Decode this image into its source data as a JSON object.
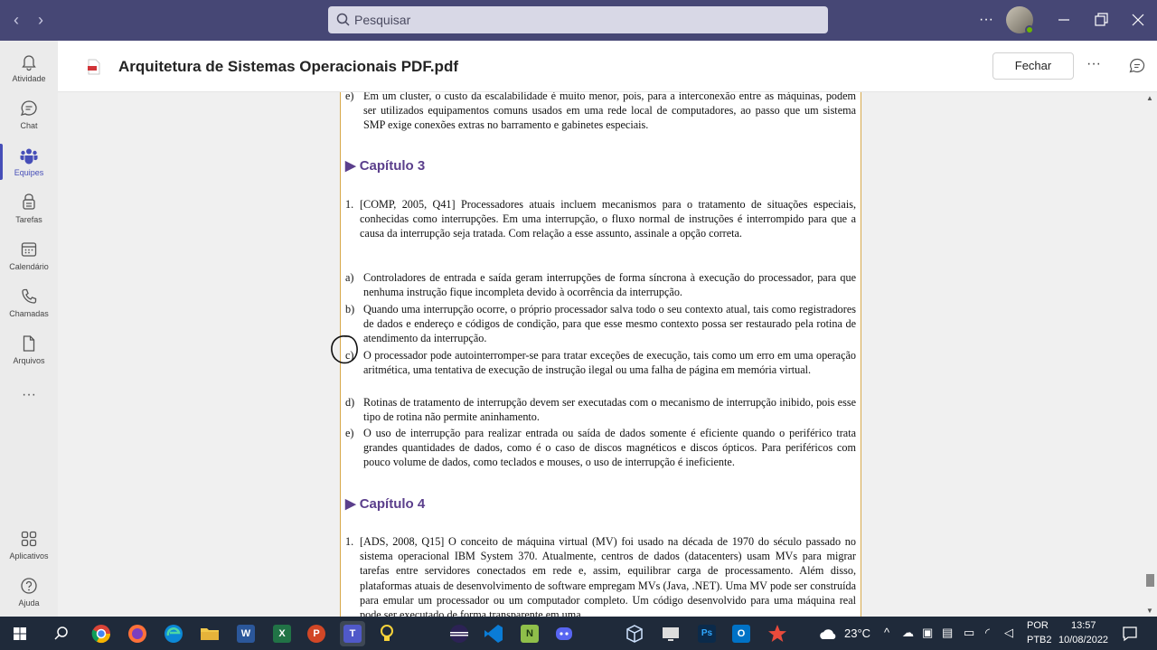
{
  "titlebar": {
    "search_placeholder": "Pesquisar",
    "back_icon": "arrow-left-icon",
    "forward_icon": "arrow-right-icon",
    "more_label": "···"
  },
  "rail": {
    "items": [
      {
        "label": "Atividade",
        "icon": "bell-icon"
      },
      {
        "label": "Chat",
        "icon": "chat-icon"
      },
      {
        "label": "Equipes",
        "icon": "teams-icon",
        "active": true
      },
      {
        "label": "Tarefas",
        "icon": "tasks-icon"
      },
      {
        "label": "Calendário",
        "icon": "calendar-icon"
      },
      {
        "label": "Chamadas",
        "icon": "phone-icon"
      },
      {
        "label": "Arquivos",
        "icon": "file-icon"
      }
    ],
    "more": "···",
    "apps_label": "Aplicativos",
    "help_label": "Ajuda"
  },
  "document": {
    "title": "Arquitetura de Sistemas Operacionais PDF.pdf",
    "close_label": "Fechar",
    "more_label": "···"
  },
  "pdf": {
    "top_item": {
      "marker": "e)",
      "text": "Em um cluster, o custo da escalabilidade é muito menor, pois, para a interconexão entre as máquinas, podem ser utilizados equipamentos comuns usados em uma rede local de computadores, ao passo que um sistema SMP exige conexões extras no barramento e gabinetes especiais."
    },
    "chapter3": "▶ Capítulo 3",
    "question1": {
      "marker": "1.",
      "text": "[COMP, 2005, Q41] Processadores atuais incluem mecanismos para o tratamento de situações especiais, conhecidas como interrupções. Em uma interrupção, o fluxo normal de instruções é interrompido para que a causa da interrupção seja tratada. Com relação a esse assunto, assinale a opção correta."
    },
    "options": [
      {
        "marker": "a)",
        "text": "Controladores de entrada e saída geram interrupções de forma síncrona à execução do processador, para que nenhuma instrução fique incompleta devido à ocorrência da interrupção."
      },
      {
        "marker": "b)",
        "text": "Quando uma interrupção ocorre, o próprio processador salva todo o seu contexto atual, tais como registradores de dados e endereço e códigos de condição, para que esse mesmo contexto possa ser restaurado pela rotina de atendimento da interrupção."
      },
      {
        "marker": "c)",
        "text": "O processador pode autointerromper-se para tratar exceções de execução, tais como um erro em uma operação aritmética, uma tentativa de execução de instrução ilegal ou uma falha de página em memória virtual."
      },
      {
        "marker": "d)",
        "text": "Rotinas de tratamento de interrupção devem ser executadas com o mecanismo de interrupção inibido, pois esse tipo de rotina não permite aninhamento."
      },
      {
        "marker": "e)",
        "text": "O uso de interrupção para realizar entrada ou saída de dados somente é eficiente quando o periférico trata grandes quantidades de dados, como é o caso de discos magnéticos e discos ópticos. Para periféricos com pouco volume de dados, como teclados e mouses, o uso de interrupção é ineficiente."
      }
    ],
    "chapter4": "▶ Capítulo 4",
    "question2": {
      "marker": "1.",
      "text": "[ADS, 2008, Q15] O conceito de máquina virtual (MV) foi usado na década de 1970 do século passado no sistema operacional IBM System 370. Atualmente, centros de dados (datacenters) usam MVs para migrar tarefas entre servidores conectados em rede e, assim, equilibrar carga de processamento. Além disso, plataformas atuais de desenvolvimento de software empregam MVs (Java, .NET). Uma MV pode ser construída para emular um processador ou um computador completo. Um código desenvolvido para uma máquina real pode ser executado de forma transparente em uma"
    }
  },
  "taskbar": {
    "weather": "23°C",
    "lang_top": "POR",
    "lang_bottom": "PTB2",
    "time": "13:57",
    "date": "10/08/2022",
    "apps": [
      {
        "name": "windows-start-icon",
        "color": "#1e90ff",
        "glyph": "⊞"
      },
      {
        "name": "search-icon",
        "color": "transparent",
        "glyph": "⌕"
      },
      {
        "name": "chrome-icon",
        "color": "#e0a000",
        "glyph": "●"
      },
      {
        "name": "firefox-icon",
        "color": "#ff6a1a",
        "glyph": "●"
      },
      {
        "name": "edge-icon",
        "color": "#1d9bd7",
        "glyph": "e"
      },
      {
        "name": "file-explorer-icon",
        "color": "#f2c84b",
        "glyph": "▬"
      },
      {
        "name": "word-icon",
        "color": "#2b579a",
        "glyph": "W"
      },
      {
        "name": "excel-icon",
        "color": "#217346",
        "glyph": "X"
      },
      {
        "name": "powerpoint-icon",
        "color": "#d24726",
        "glyph": "P"
      },
      {
        "name": "teams-icon",
        "color": "#5059c9",
        "glyph": "T",
        "active": true
      },
      {
        "name": "lightbulb-icon",
        "color": "transparent",
        "glyph": "💡"
      },
      {
        "name": "eclipse-icon",
        "color": "#2c2255",
        "glyph": "◐"
      },
      {
        "name": "vscode-icon",
        "color": "#0078d4",
        "glyph": "◆"
      },
      {
        "name": "notepadpp-icon",
        "color": "#8fbf4a",
        "glyph": "N"
      },
      {
        "name": "discord-icon",
        "color": "#5865f2",
        "glyph": "◎"
      },
      {
        "name": "virtualbox-icon",
        "color": "#1b5fa8",
        "glyph": "▣"
      },
      {
        "name": "screen-icon",
        "color": "#444",
        "glyph": "▭"
      },
      {
        "name": "photoshop-icon",
        "color": "#0b2a4a",
        "glyph": "Ps"
      },
      {
        "name": "outlook-icon",
        "color": "#0072c6",
        "glyph": "O"
      },
      {
        "name": "star-app-icon",
        "color": "#c23a2e",
        "glyph": "★"
      }
    ]
  }
}
